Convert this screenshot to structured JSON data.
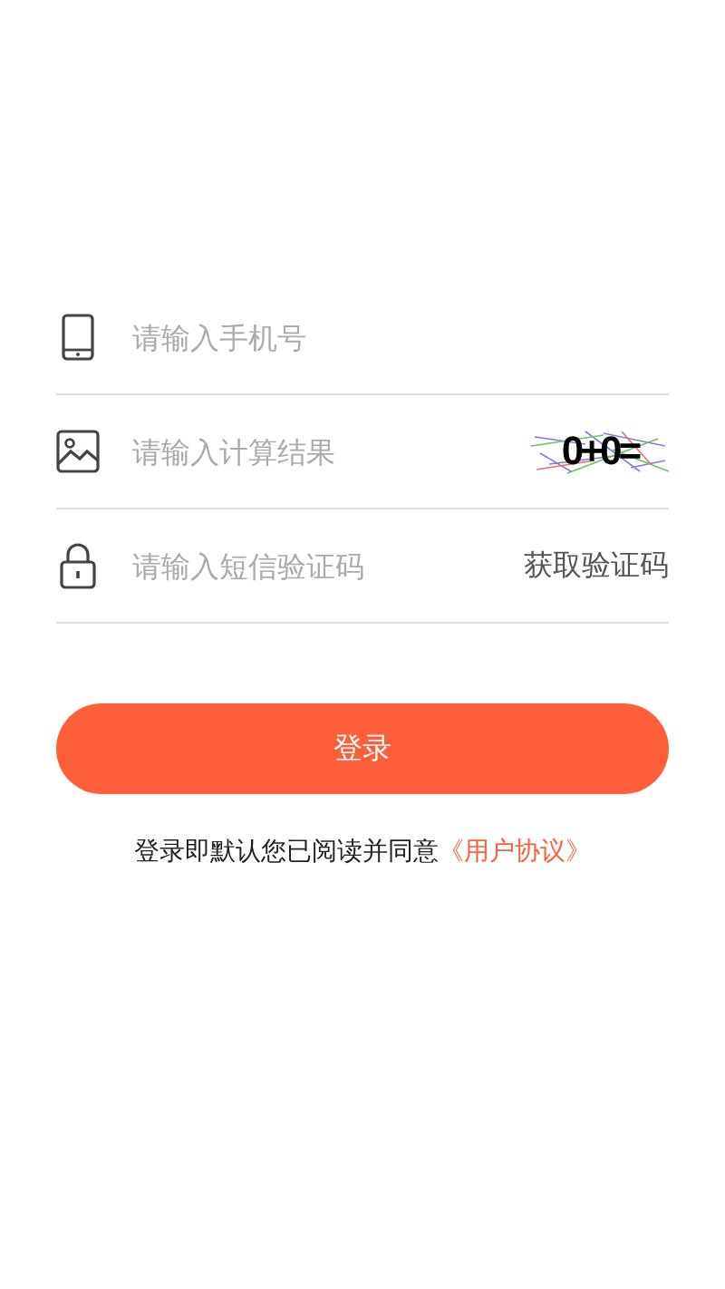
{
  "fields": [
    {
      "kind": "phone",
      "placeholder": "请输入手机号"
    },
    {
      "kind": "captcha",
      "placeholder": "请输入计算结果",
      "captcha": "0+0="
    },
    {
      "kind": "sms",
      "placeholder": "请输入短信验证码",
      "action": "获取验证码"
    }
  ],
  "login_button": "登录",
  "agreement": {
    "text": "登录即默认您已阅读并同意",
    "link": "《用户协议》"
  }
}
